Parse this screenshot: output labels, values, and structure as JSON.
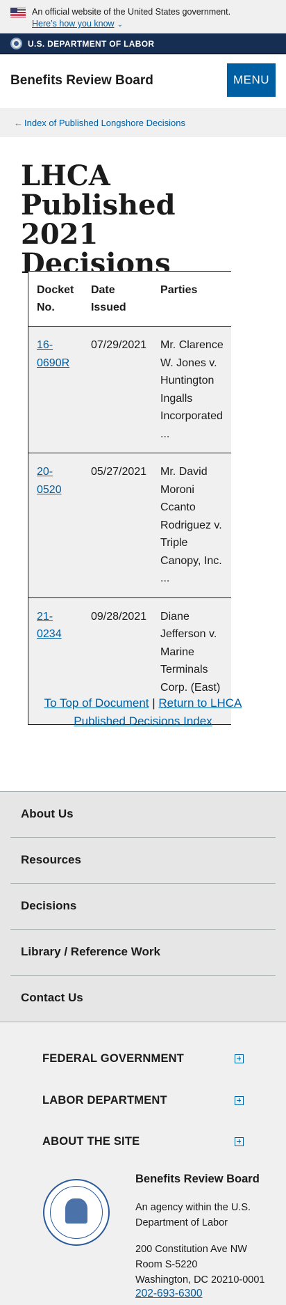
{
  "gov_banner": {
    "text": "An official website of the United States government.",
    "link": "Here’s how you know"
  },
  "dept": {
    "name": "U.S. DEPARTMENT OF LABOR"
  },
  "header": {
    "site_title": "Benefits Review Board",
    "menu_label": "MENU"
  },
  "breadcrumb": {
    "label": "Index of Published Longshore Decisions"
  },
  "page": {
    "title_line1": "LHCA Published",
    "title_line2": "2021 Decisions"
  },
  "table": {
    "headers": [
      "Docket No.",
      "Date Issued",
      "Parties"
    ],
    "rows": [
      {
        "docket": "16-0690R",
        "date": "07/29/2021",
        "parties": "Mr. Clarence W. Jones v. Huntington Ingalls Incorporated ..."
      },
      {
        "docket": "20-0520",
        "date": "05/27/2021",
        "parties": "Mr. David Moroni Ccanto Rodriguez v. Triple Canopy, Inc. ..."
      },
      {
        "docket": "21-0234",
        "date": "09/28/2021",
        "parties": "Diane Jefferson v. Marine Terminals Corp. (East) ..."
      }
    ]
  },
  "doc_links": {
    "top": "To Top of Document",
    "separator": "|",
    "return": "Return to LHCA Published Decisions Index"
  },
  "footer_nav": [
    "About Us",
    "Resources",
    "Decisions",
    "Library / Reference Work",
    "Contact Us"
  ],
  "accordion": [
    "FEDERAL GOVERNMENT",
    "LABOR DEPARTMENT",
    "ABOUT THE SITE"
  ],
  "agency": {
    "name": "Benefits Review Board",
    "sub": "An agency within the U.S. Department of Labor",
    "address1": "200 Constitution Ave NW",
    "address2": "Room S-5220",
    "address3": "Washington, DC 20210-0001",
    "phone": "202-693-6300"
  },
  "colors": {
    "link": "#005ea2",
    "dept_bar": "#162e51",
    "banner": "#f0f0f0"
  }
}
